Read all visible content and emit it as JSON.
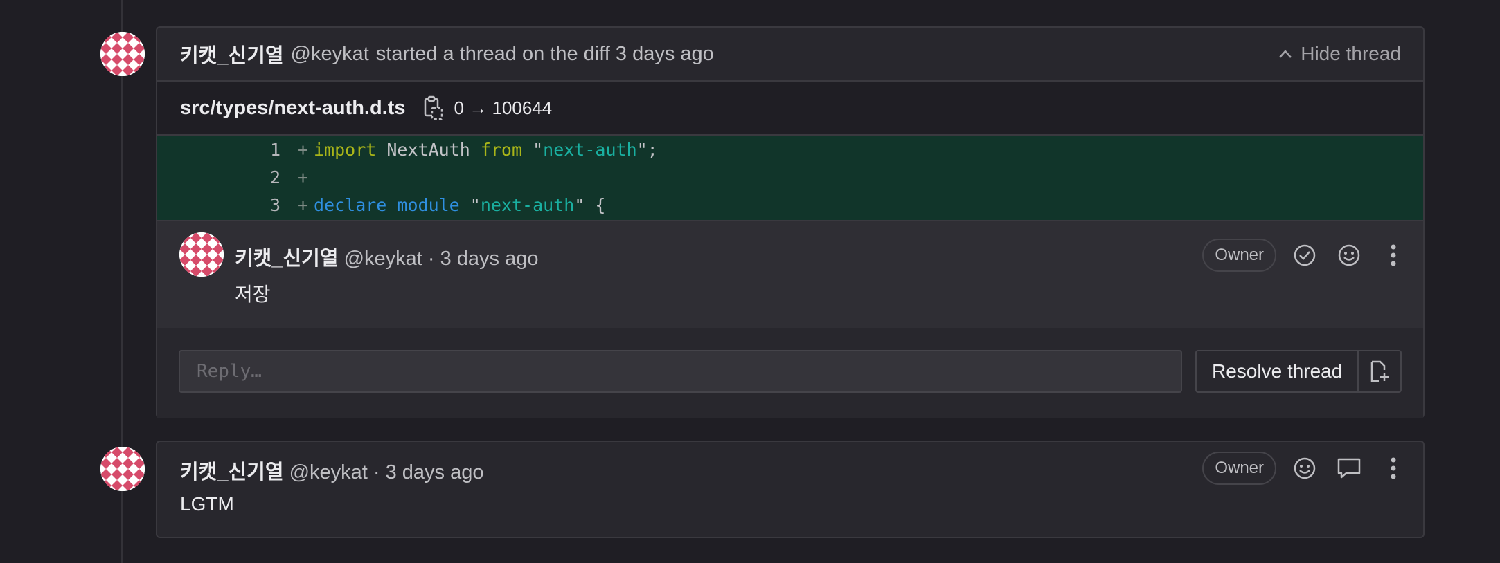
{
  "thread": {
    "author_name": "키캣_신기열",
    "author_handle": "@keykat",
    "action_text": "started a thread on the diff 3 days ago",
    "hide_label": "Hide thread",
    "file": {
      "path": "src/types/next-auth.d.ts",
      "mode_change": "0 → 100644"
    },
    "diff_lines": [
      {
        "num": "1",
        "tokens": [
          {
            "t": "import",
            "c": "kw-yellow"
          },
          {
            "t": " NextAuth ",
            "c": "plain"
          },
          {
            "t": "from",
            "c": "kw-yellow"
          },
          {
            "t": " \"",
            "c": "plain"
          },
          {
            "t": "next-auth",
            "c": "str"
          },
          {
            "t": "\";",
            "c": "plain"
          }
        ]
      },
      {
        "num": "2",
        "tokens": []
      },
      {
        "num": "3",
        "tokens": [
          {
            "t": "declare",
            "c": "kw-blue"
          },
          {
            "t": " ",
            "c": "plain"
          },
          {
            "t": "module",
            "c": "kw-blue"
          },
          {
            "t": " \"",
            "c": "plain"
          },
          {
            "t": "next-auth",
            "c": "str"
          },
          {
            "t": "\" {",
            "c": "plain"
          }
        ]
      }
    ],
    "note": {
      "author_name": "키캣_신기열",
      "meta": "@keykat · 3 days ago",
      "badge": "Owner",
      "body": "저장"
    },
    "reply_placeholder": "Reply…",
    "resolve_label": "Resolve thread"
  },
  "comment": {
    "author_name": "키캣_신기열",
    "meta": "@keykat · 3 days ago",
    "badge": "Owner",
    "body": "LGTM"
  },
  "colors": {
    "background": "#1f1e24",
    "card": "#28272d",
    "diff_added": "#11352a",
    "avatar_accent": "#d64b6a"
  }
}
